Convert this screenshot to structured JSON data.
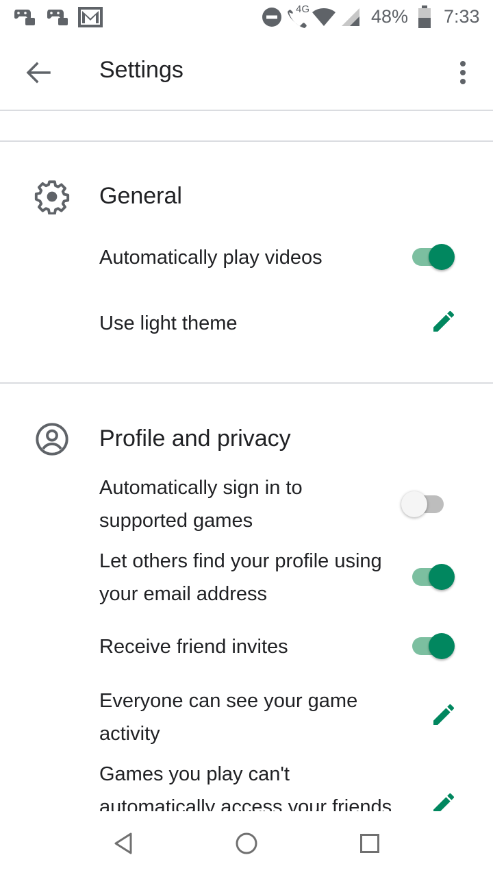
{
  "status_bar": {
    "network_label": "4G",
    "battery": "48%",
    "time": "7:33",
    "icons": [
      "game-controller-icon",
      "game-controller-icon",
      "gmail-icon",
      "do-not-disturb-icon",
      "call-icon",
      "wifi-icon",
      "signal-icon",
      "battery-icon"
    ]
  },
  "app_bar": {
    "title": "Settings",
    "back_icon": "arrow-back-icon",
    "menu_icon": "more-vert-icon"
  },
  "sections": [
    {
      "title": "General",
      "icon": "gear-icon",
      "items": [
        {
          "label": "Automatically play videos",
          "control": "toggle",
          "checked": true
        },
        {
          "label": "Use light theme",
          "control": "edit"
        }
      ]
    },
    {
      "title": "Profile and privacy",
      "icon": "account-circle-icon",
      "items": [
        {
          "label": "Automatically sign in to supported games",
          "control": "toggle",
          "checked": false
        },
        {
          "label": "Let others find your profile using your email address",
          "control": "toggle",
          "checked": true
        },
        {
          "label": "Receive friend invites",
          "control": "toggle",
          "checked": true
        },
        {
          "label": "Everyone can see your game activity",
          "control": "edit"
        },
        {
          "label": "Games you play can't automatically access your friends",
          "control": "edit"
        }
      ]
    }
  ],
  "nav_bar": {
    "icons": [
      "back-triangle-icon",
      "home-circle-icon",
      "recents-square-icon"
    ]
  },
  "colors": {
    "accent": "#01875f",
    "accent_track": "#7cbfa0",
    "text": "#202124",
    "icon_gray": "#5f6368",
    "divider": "#dadce0"
  }
}
